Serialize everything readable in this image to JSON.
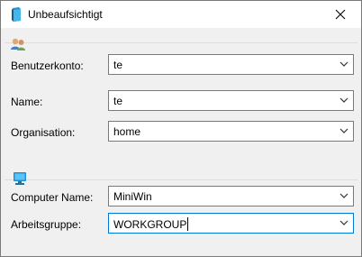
{
  "window": {
    "title": "Unbeaufsichtigt"
  },
  "icons": {
    "app": "book-icon",
    "close": "close-icon",
    "user_group": "users-icon",
    "computer_group": "computer-icon",
    "dropdown": "chevron-down-icon"
  },
  "user_section": {
    "account": {
      "label": "Benutzerkonto:",
      "value": "te"
    },
    "name": {
      "label": "Name:",
      "value": "te"
    },
    "organization": {
      "label": "Organisation:",
      "value": "home"
    }
  },
  "computer_section": {
    "computer_name": {
      "label": "Computer Name:",
      "value": "MiniWin"
    },
    "workgroup": {
      "label": "Arbeitsgruppe:",
      "value": "WORKGROUP"
    }
  },
  "colors": {
    "window_bg": "#f0f0f0",
    "titlebar_bg": "#ffffff",
    "field_border": "#7a7a7a",
    "focus_border": "#0078d7",
    "group_line": "#d5dfe5"
  }
}
